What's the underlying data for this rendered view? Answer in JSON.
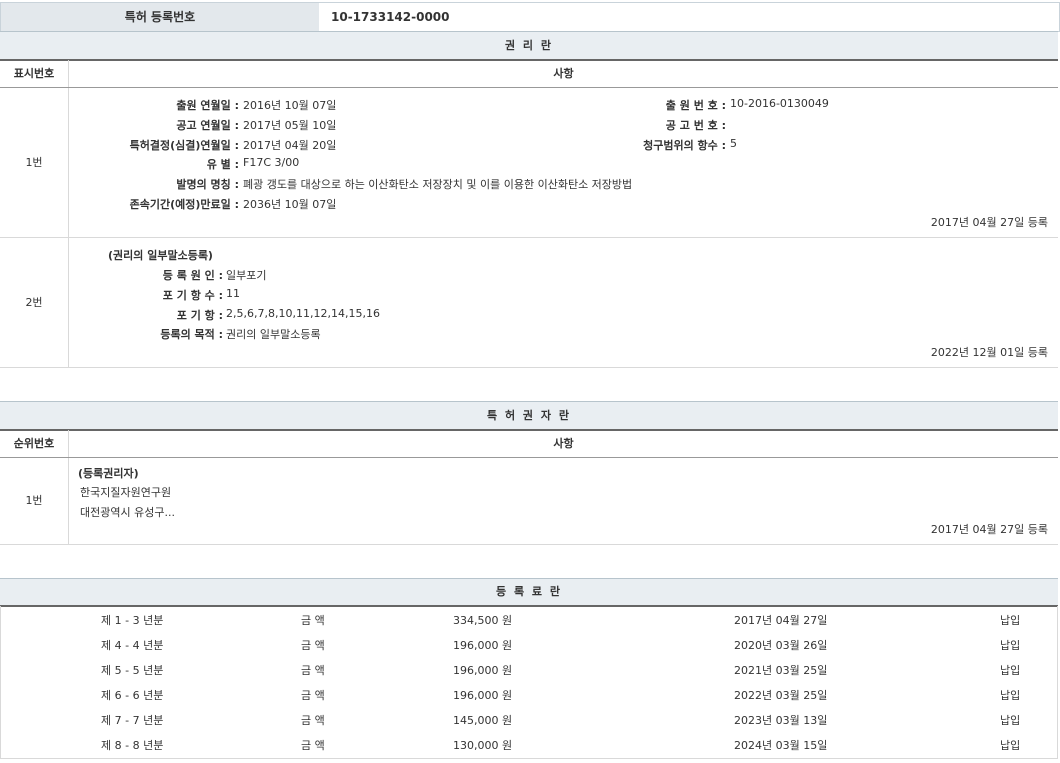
{
  "reg_no": {
    "label": "특허 등록번호",
    "value": "10-1733142-0000"
  },
  "rights": {
    "title": "권 리 란",
    "col_no": "표시번호",
    "col_items": "사항",
    "row1": {
      "no": "1번",
      "left": [
        {
          "label": "출원 연월일 :",
          "value": "2016년 10월 07일"
        },
        {
          "label": "공고 연월일 :",
          "value": "2017년 05월 10일"
        },
        {
          "label": "특허결정(심결)연월일 :",
          "value": "2017년 04월 20일"
        },
        {
          "label": "유 별 :",
          "value": "F17C 3/00"
        },
        {
          "label": "발명의 명칭 :",
          "value": "폐광 갱도를 대상으로 하는 이산화탄소 저장장치 및 이를 이용한 이산화탄소 저장방법"
        },
        {
          "label": "존속기간(예정)만료일 :",
          "value": "2036년 10월 07일"
        }
      ],
      "right": [
        {
          "label": "출 원 번 호 :",
          "value": "10-2016-0130049"
        },
        {
          "label": "공 고 번 호 :",
          "value": ""
        },
        {
          "label": "청구범위의 항수 :",
          "value": "5"
        }
      ],
      "date": "2017년 04월 27일 등록"
    },
    "row2": {
      "no": "2번",
      "heading": "(권리의 일부말소등록)",
      "items": [
        {
          "label": "등 록 원 인 :",
          "value": "일부포기"
        },
        {
          "label": "포 기 항 수 :",
          "value": "11"
        },
        {
          "label": "포 기 항 :",
          "value": "2,5,6,7,8,10,11,12,14,15,16"
        },
        {
          "label": "등록의 목적 :",
          "value": "권리의 일부말소등록"
        }
      ],
      "date": "2022년 12월 01일 등록"
    }
  },
  "holders": {
    "title": "특 허 권 자 란",
    "col_no": "순위번호",
    "col_items": "사항",
    "row1": {
      "no": "1번",
      "heading": "(등록권리자)",
      "name": "한국지질자원연구원",
      "address": "대전광역시 유성구...",
      "date": "2017년 04월 27일 등록"
    }
  },
  "fees": {
    "title": "등 록 료 란",
    "rows": [
      {
        "period": "제 1 - 3 년분",
        "label": "금 액",
        "amount": "334,500 원",
        "date": "2017년 04월 27일",
        "status": "납입"
      },
      {
        "period": "제 4 - 4 년분",
        "label": "금 액",
        "amount": "196,000 원",
        "date": "2020년 03월 26일",
        "status": "납입"
      },
      {
        "period": "제 5 - 5 년분",
        "label": "금 액",
        "amount": "196,000 원",
        "date": "2021년 03월 25일",
        "status": "납입"
      },
      {
        "period": "제 6 - 6 년분",
        "label": "금 액",
        "amount": "196,000 원",
        "date": "2022년 03월 25일",
        "status": "납입"
      },
      {
        "period": "제 7 - 7 년분",
        "label": "금 액",
        "amount": "145,000 원",
        "date": "2023년 03월 13일",
        "status": "납입"
      },
      {
        "period": "제 8 - 8 년분",
        "label": "금 액",
        "amount": "130,000 원",
        "date": "2024년 03월 15일",
        "status": "납입"
      }
    ]
  }
}
